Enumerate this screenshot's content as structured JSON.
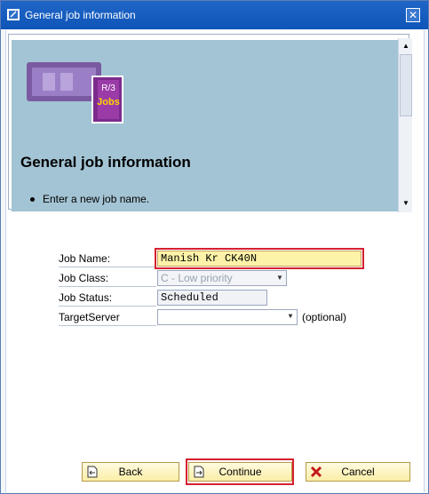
{
  "window": {
    "title": "General job information",
    "close_label": "✕"
  },
  "info": {
    "heading": "General job information",
    "bullet": "Enter a new job name.",
    "logo_text_r3": "R/3",
    "logo_text_jobs": "Jobs"
  },
  "form": {
    "job_name": {
      "label": "Job Name:",
      "value": "Manish Kr CK40N"
    },
    "job_class": {
      "label": "Job Class:",
      "value": "C - Low priority"
    },
    "job_status": {
      "label": "Job Status:",
      "value": "Scheduled"
    },
    "target_server": {
      "label": "TargetServer",
      "value": "",
      "hint": "(optional)"
    }
  },
  "buttons": {
    "back": "Back",
    "continue": "Continue",
    "cancel": "Cancel"
  },
  "colors": {
    "titlebar": "#1f66c7",
    "info_panel": "#a3c4d4",
    "button_fill": "#fbeea6",
    "highlight": "#d62030",
    "job_name_fill": "#fdf3a8"
  },
  "icons": {
    "title": "window-edit-icon",
    "close": "close-icon",
    "back": "back-document-icon",
    "continue": "continue-document-icon",
    "cancel": "cancel-x-icon"
  }
}
